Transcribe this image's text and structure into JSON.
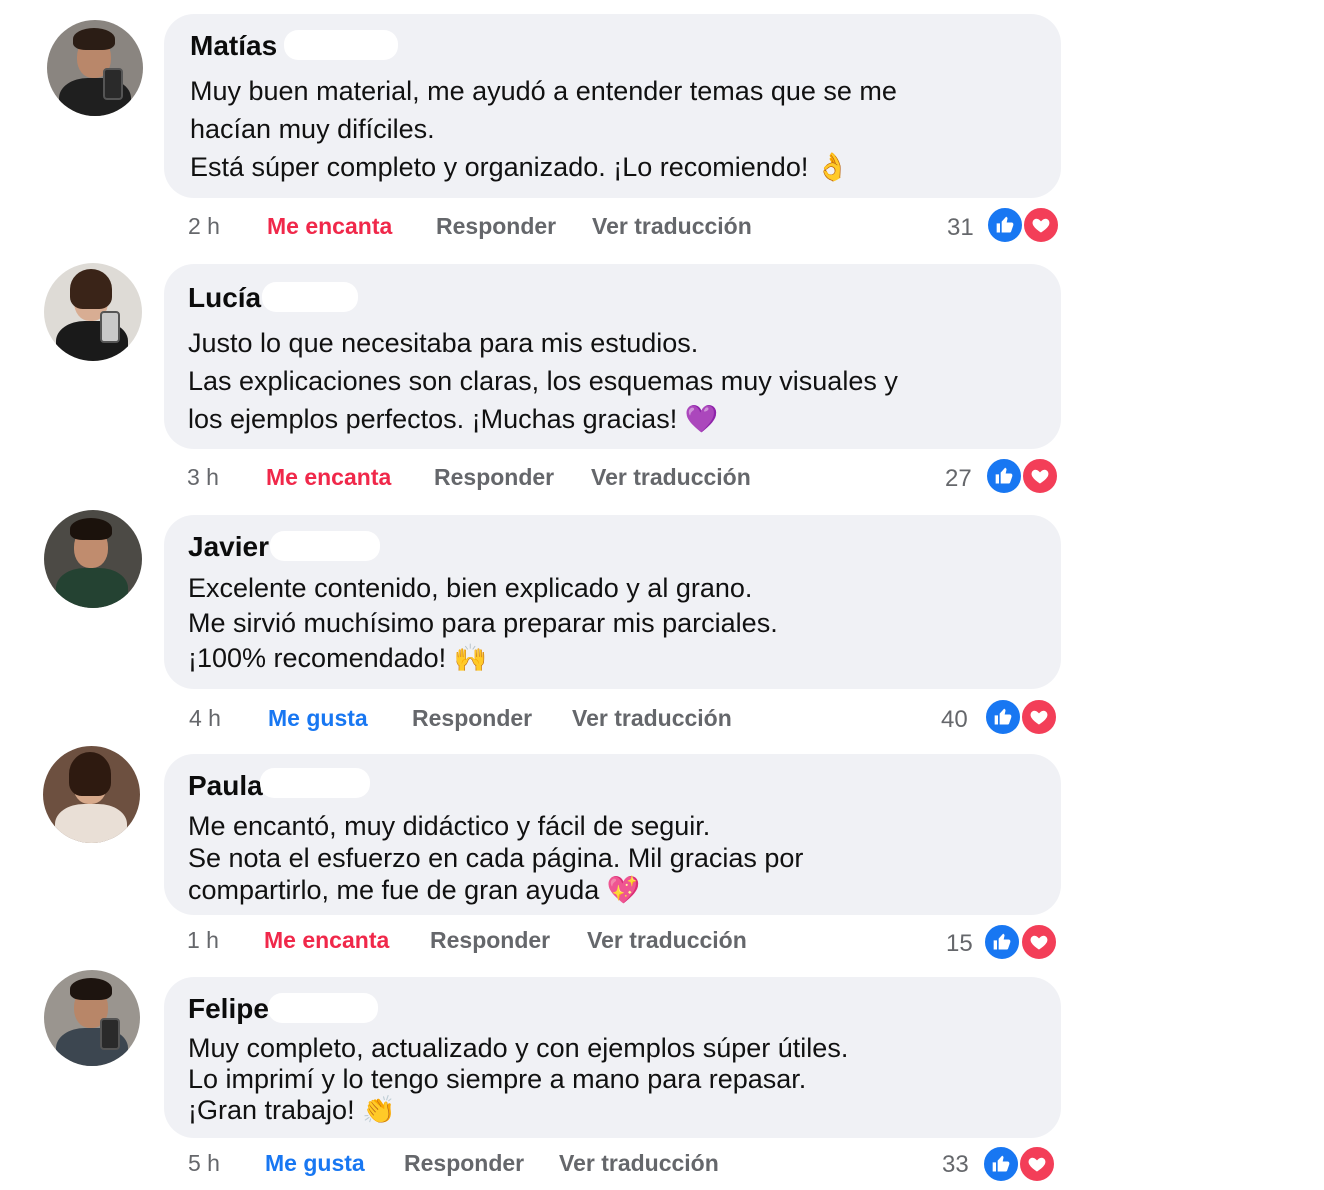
{
  "colors": {
    "bubble": "#f0f1f5",
    "me_encanta": "#f0284a",
    "me_gusta": "#1877f2",
    "secondary_text": "#65676b",
    "like_icon": "#1877f2",
    "love_icon": "#f33e58"
  },
  "comments": [
    {
      "name": "Matías",
      "lines": [
        "Muy buen material, me ayudó a entender temas que se me",
        "hacían muy difíciles.",
        "Está súper completo y organizado. ¡Lo recomiendo! 👌"
      ],
      "time": "2 h",
      "reaction_label": "Me encanta",
      "reply_label": "Responder",
      "translate_label": "Ver traducción",
      "count": "31",
      "icons": [
        "like-icon",
        "love-icon"
      ]
    },
    {
      "name": "Lucía",
      "lines": [
        "Justo lo que necesitaba para mis estudios.",
        "Las explicaciones son claras, los esquemas muy visuales y",
        "los ejemplos perfectos. ¡Muchas gracias! 💜"
      ],
      "time": "3 h",
      "reaction_label": "Me encanta",
      "reply_label": "Responder",
      "translate_label": "Ver traducción",
      "count": "27",
      "icons": [
        "like-icon",
        "love-icon"
      ]
    },
    {
      "name": "Javier",
      "lines": [
        "Excelente contenido, bien explicado y al grano.",
        "Me sirvió muchísimo para preparar mis parciales.",
        "¡100% recomendado! 🙌"
      ],
      "time": "4 h",
      "reaction_label": "Me gusta",
      "reply_label": "Responder",
      "translate_label": "Ver traducción",
      "count": "40",
      "icons": [
        "like-icon",
        "love-icon"
      ]
    },
    {
      "name": "Paula",
      "lines": [
        "Me encantó, muy didáctico y fácil de seguir.",
        "Se nota el esfuerzo en cada página. Mil gracias por",
        "compartirlo, me fue de gran ayuda 💖"
      ],
      "time": "1 h",
      "reaction_label": "Me encanta",
      "reply_label": "Responder",
      "translate_label": "Ver traducción",
      "count": "15",
      "icons": [
        "like-icon",
        "love-icon"
      ]
    },
    {
      "name": "Felipe",
      "lines": [
        "Muy completo, actualizado y con ejemplos súper útiles.",
        "Lo imprimí y lo tengo siempre a mano para repasar.",
        "¡Gran trabajo! 👏"
      ],
      "time": "5 h",
      "reaction_label": "Me gusta",
      "reply_label": "Responder",
      "translate_label": "Ver traducción",
      "count": "33",
      "icons": [
        "like-icon",
        "love-icon"
      ]
    }
  ]
}
